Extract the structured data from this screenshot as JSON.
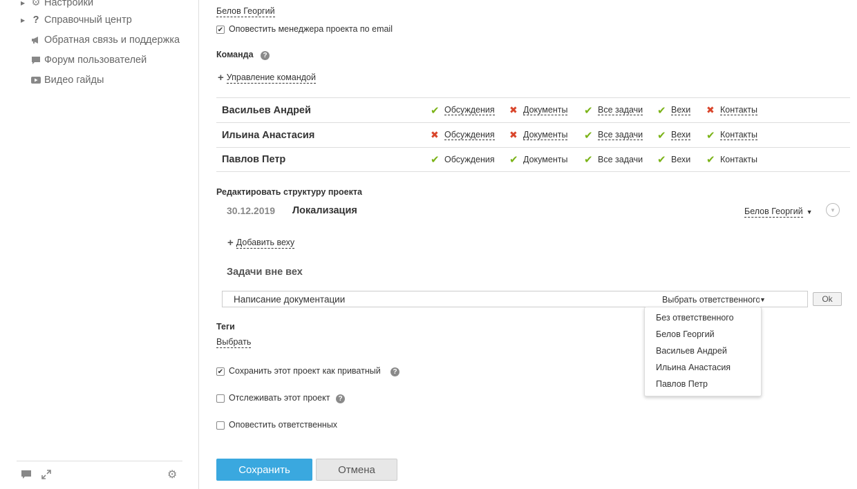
{
  "sidebar": {
    "items": [
      {
        "label": "Настройки",
        "icon": "gear-icon"
      },
      {
        "label": "Справочный центр",
        "icon": "question-icon"
      },
      {
        "label": "Обратная связь и поддержка",
        "icon": "megaphone-icon"
      },
      {
        "label": "Форум пользователей",
        "icon": "chat-icon"
      },
      {
        "label": "Видео гайды",
        "icon": "video-icon"
      }
    ]
  },
  "manager": {
    "name": "Белов Георгий",
    "notify_label": "Оповестить менеджера проекта по email",
    "notify_checked": true
  },
  "team": {
    "title": "Команда",
    "manage_label": "Управление командой",
    "members": [
      {
        "name": "Васильев Андрей",
        "perms": [
          {
            "label": "Обсуждения",
            "allowed": true
          },
          {
            "label": "Документы",
            "allowed": false
          },
          {
            "label": "Все задачи",
            "allowed": true
          },
          {
            "label": "Вехи",
            "allowed": true
          },
          {
            "label": "Контакты",
            "allowed": false
          }
        ]
      },
      {
        "name": "Ильина Анастасия",
        "perms": [
          {
            "label": "Обсуждения",
            "allowed": false
          },
          {
            "label": "Документы",
            "allowed": false
          },
          {
            "label": "Все задачи",
            "allowed": true
          },
          {
            "label": "Вехи",
            "allowed": true
          },
          {
            "label": "Контакты",
            "allowed": true
          }
        ]
      },
      {
        "name": "Павлов Петр",
        "perms": [
          {
            "label": "Обсуждения",
            "allowed": true
          },
          {
            "label": "Документы",
            "allowed": true
          },
          {
            "label": "Все задачи",
            "allowed": true
          },
          {
            "label": "Вехи",
            "allowed": true
          },
          {
            "label": "Контакты",
            "allowed": true
          }
        ]
      }
    ]
  },
  "structure": {
    "title": "Редактировать структуру проекта",
    "milestone": {
      "date": "30.12.2019",
      "name": "Локализация",
      "responsible": "Белов Георгий"
    },
    "add_milestone_label": "Добавить веху",
    "tasks_title": "Задачи вне вех",
    "task_value": "Написание документации",
    "responsible_select": "Выбрать ответственного",
    "ok_label": "Ok",
    "dropdown_options": [
      "Без ответственного",
      "Белов Георгий",
      "Васильев Андрей",
      "Ильина Анастасия",
      "Павлов Петр"
    ]
  },
  "tags": {
    "title": "Теги",
    "select_label": "Выбрать"
  },
  "options": {
    "private": {
      "label": "Сохранить этот проект как приватный",
      "checked": true
    },
    "follow": {
      "label": "Отслеживать этот проект",
      "checked": false
    },
    "notify": {
      "label": "Оповестить ответственных",
      "checked": false
    }
  },
  "buttons": {
    "save": "Сохранить",
    "cancel": "Отмена"
  },
  "colors": {
    "accent": "#3aa8df",
    "allowed": "#7ab317",
    "denied": "#d9452b"
  }
}
